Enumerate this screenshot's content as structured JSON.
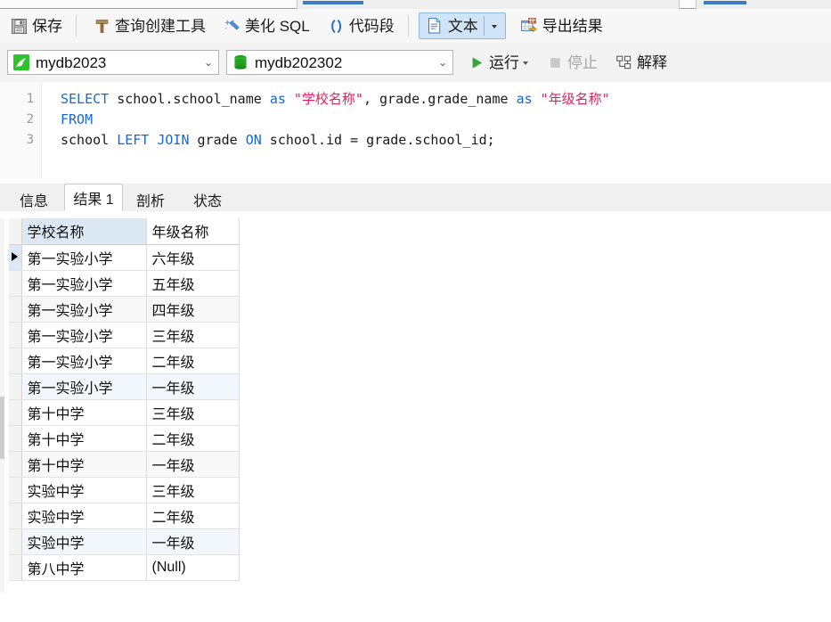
{
  "toolbar_main": {
    "buttons": [
      {
        "id": "save",
        "label": "保存",
        "icon": "floppy-disk-icon"
      },
      {
        "id": "query-build",
        "label": "查询创建工具",
        "icon": "query-builder-icon"
      },
      {
        "id": "beautify",
        "label": "美化 SQL",
        "icon": "magic-wand-icon"
      },
      {
        "id": "snippet",
        "label": "代码段",
        "icon": "parentheses-icon"
      },
      {
        "id": "text-view",
        "label": "文本",
        "icon": "document-icon"
      },
      {
        "id": "export",
        "label": "导出结果",
        "icon": "export-grid-icon"
      }
    ]
  },
  "toolbar_run": {
    "connection": {
      "value": "mydb2023",
      "icon": "mysql-dolphin-icon"
    },
    "database": {
      "value": "mydb202302",
      "icon": "database-cylinder-icon"
    },
    "run": {
      "label": "运行",
      "icon": "play-icon",
      "enabled": true
    },
    "stop": {
      "label": "停止",
      "icon": "stop-icon",
      "enabled": false
    },
    "explain": {
      "label": "解释",
      "icon": "explain-icon",
      "enabled": true
    }
  },
  "editor": {
    "lines": [
      {
        "number": "1",
        "tokens": [
          {
            "t": "SELECT",
            "c": "kw"
          },
          {
            "t": " school.school_name ",
            "c": "pl"
          },
          {
            "t": "as",
            "c": "kw"
          },
          {
            "t": " ",
            "c": "pl"
          },
          {
            "t": "\"学校名称\"",
            "c": "str"
          },
          {
            "t": ", grade.grade_name ",
            "c": "pl"
          },
          {
            "t": "as",
            "c": "kw"
          },
          {
            "t": " ",
            "c": "pl"
          },
          {
            "t": "\"年级名称\"",
            "c": "str"
          }
        ]
      },
      {
        "number": "2",
        "tokens": [
          {
            "t": "FROM",
            "c": "kw"
          }
        ]
      },
      {
        "number": "3",
        "tokens": [
          {
            "t": "school ",
            "c": "pl"
          },
          {
            "t": "LEFT",
            "c": "kw"
          },
          {
            "t": " ",
            "c": "pl"
          },
          {
            "t": "JOIN",
            "c": "kw"
          },
          {
            "t": " grade ",
            "c": "pl"
          },
          {
            "t": "ON",
            "c": "kw"
          },
          {
            "t": " school.id = grade.school_id;",
            "c": "pl"
          }
        ]
      }
    ]
  },
  "result_tabs": [
    {
      "label": "信息",
      "active": false
    },
    {
      "label": "结果 1",
      "active": true
    },
    {
      "label": "剖析",
      "active": false
    },
    {
      "label": "状态",
      "active": false
    }
  ],
  "grid": {
    "columns": [
      "学校名称",
      "年级名称"
    ],
    "null_text": "(Null)",
    "rows": [
      {
        "cells": [
          "第一实验小学",
          "六年级"
        ],
        "selected": true
      },
      {
        "cells": [
          "第一实验小学",
          "五年级"
        ],
        "selected": false
      },
      {
        "cells": [
          "第一实验小学",
          "四年级"
        ],
        "selected": false
      },
      {
        "cells": [
          "第一实验小学",
          "三年级"
        ],
        "selected": false
      },
      {
        "cells": [
          "第一实验小学",
          "二年级"
        ],
        "selected": false
      },
      {
        "cells": [
          "第一实验小学",
          "一年级"
        ],
        "selected": false
      },
      {
        "cells": [
          "第十中学",
          "三年级"
        ],
        "selected": false
      },
      {
        "cells": [
          "第十中学",
          "二年级"
        ],
        "selected": false
      },
      {
        "cells": [
          "第十中学",
          "一年级"
        ],
        "selected": false
      },
      {
        "cells": [
          "实验中学",
          "三年级"
        ],
        "selected": false
      },
      {
        "cells": [
          "实验中学",
          "二年级"
        ],
        "selected": false
      },
      {
        "cells": [
          "实验中学",
          "一年级"
        ],
        "selected": false
      },
      {
        "cells": [
          "第八中学",
          "(Null)"
        ],
        "selected": false,
        "null_cols": [
          1
        ]
      }
    ]
  },
  "colors": {
    "accent_blue": "#1668d8",
    "string_red": "#e0215e",
    "header_blue": "#dce9f5",
    "run_green": "#3aa33a"
  }
}
